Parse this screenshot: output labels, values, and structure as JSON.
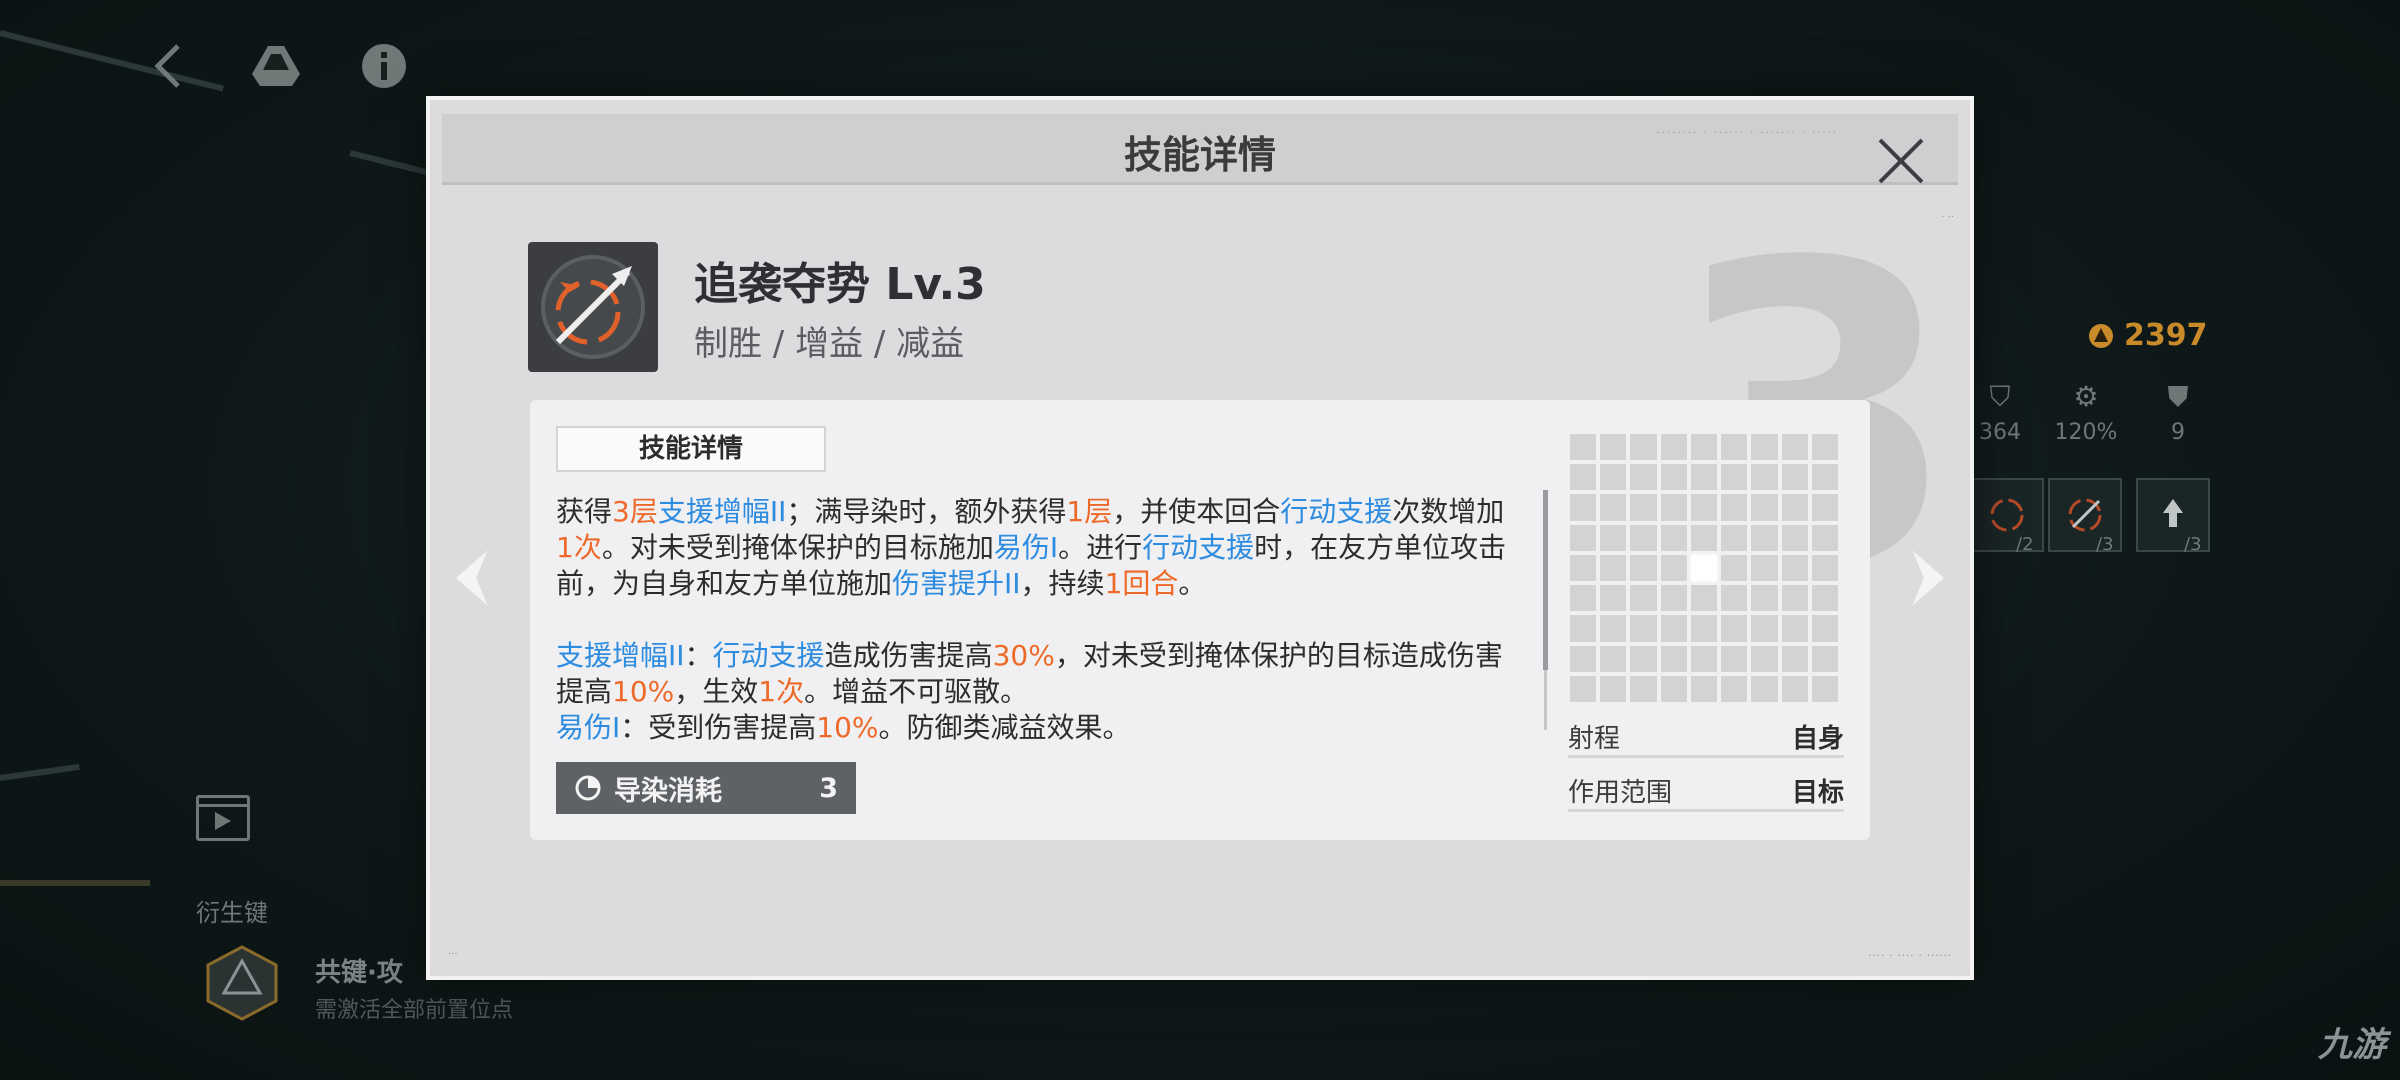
{
  "modal": {
    "title": "技能详情",
    "big_level": "3"
  },
  "skill": {
    "name": "追袭夺势 Lv.3",
    "tags": "制胜 / 增益 / 减益"
  },
  "card": {
    "tab_label": "技能详情",
    "description": {
      "p1": [
        {
          "t": "获得",
          "c": ""
        },
        {
          "t": "3层",
          "c": "orange"
        },
        {
          "t": "支援增幅II",
          "c": "blue"
        },
        {
          "t": "；满导染时，额外获得",
          "c": ""
        },
        {
          "t": "1层",
          "c": "orange"
        },
        {
          "t": "，并使本回合",
          "c": ""
        },
        {
          "t": "行动支援",
          "c": "blue"
        },
        {
          "t": "次数增加",
          "c": ""
        },
        {
          "t": "1次",
          "c": "orange"
        },
        {
          "t": "。对未受到掩体保护的目标施加",
          "c": ""
        },
        {
          "t": "易伤I",
          "c": "blue"
        },
        {
          "t": "。进行",
          "c": ""
        },
        {
          "t": "行动支援",
          "c": "blue"
        },
        {
          "t": "时，在友方单位攻击前，为自身和友方单位施加",
          "c": ""
        },
        {
          "t": "伤害提升II",
          "c": "blue"
        },
        {
          "t": "，持续",
          "c": ""
        },
        {
          "t": "1回合",
          "c": "orange"
        },
        {
          "t": "。",
          "c": ""
        }
      ],
      "p2": [
        {
          "t": "支援增幅II",
          "c": "blue"
        },
        {
          "t": "：",
          "c": ""
        },
        {
          "t": "行动支援",
          "c": "blue"
        },
        {
          "t": "造成伤害提高",
          "c": ""
        },
        {
          "t": "30%",
          "c": "orange"
        },
        {
          "t": "，对未受到掩体保护的目标造成伤害提高",
          "c": ""
        },
        {
          "t": "10%",
          "c": "orange"
        },
        {
          "t": "，生效",
          "c": ""
        },
        {
          "t": "1次",
          "c": "orange"
        },
        {
          "t": "。增益不可驱散。",
          "c": ""
        }
      ],
      "p3": [
        {
          "t": "易伤I",
          "c": "blue"
        },
        {
          "t": "：受到伤害提高",
          "c": ""
        },
        {
          "t": "10%",
          "c": "orange"
        },
        {
          "t": "。防御类减益效果。",
          "c": ""
        }
      ]
    },
    "cost": {
      "label": "导染消耗",
      "value": "3",
      "icon": "pie-chart-icon"
    },
    "range_grid": {
      "size": 9,
      "active_cells": [
        [
          4,
          4
        ]
      ]
    },
    "info": {
      "range_label": "射程",
      "range_value": "自身",
      "area_label": "作用范围",
      "area_value": "目标"
    }
  },
  "background": {
    "resource_value": "2397",
    "stats": [
      "364",
      "120%",
      "9"
    ],
    "slot_counts": [
      "/2",
      "/3",
      "/3"
    ],
    "derived_label": "衍生键",
    "derived_name": "共键·攻",
    "derived_sub": "需激活全部前置位点",
    "watermark": "九游"
  },
  "colors": {
    "highlight_blue": "#2e8ce0",
    "highlight_orange": "#ee6a2a",
    "resource_gold": "#c98a2a"
  }
}
